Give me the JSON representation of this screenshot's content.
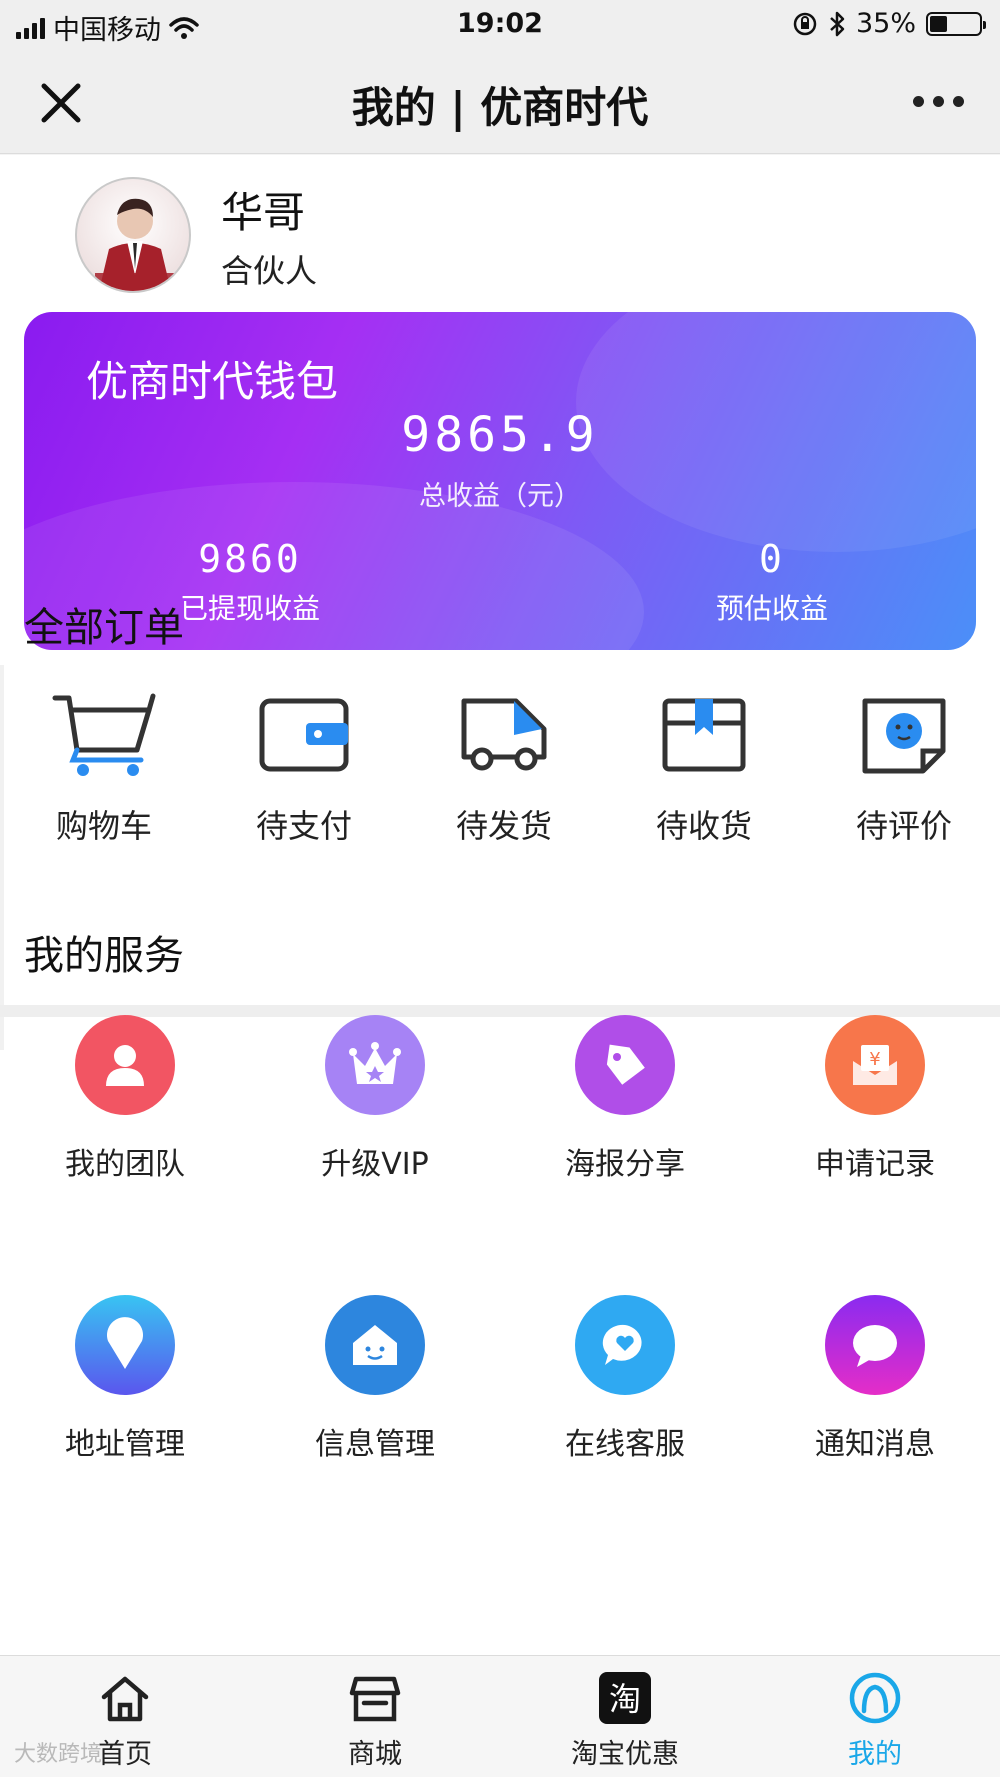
{
  "status_bar": {
    "carrier": "中国移动",
    "time": "19:02",
    "battery": "35%",
    "battery_level": 0.35
  },
  "nav": {
    "title": "我的 | 优商时代"
  },
  "profile": {
    "name": "华哥",
    "role": "合伙人"
  },
  "wallet": {
    "title": "优商时代钱包",
    "total": "9865.9",
    "total_label": "总收益（元）",
    "withdrawn": "9860",
    "withdrawn_label": "已提现收益",
    "estimated": "0",
    "estimated_label": "预估收益"
  },
  "orders": {
    "title": "全部订单",
    "items": [
      {
        "label": "购物车",
        "icon": "shopping-cart-icon"
      },
      {
        "label": "待支付",
        "icon": "wallet-icon"
      },
      {
        "label": "待发货",
        "icon": "truck-icon"
      },
      {
        "label": "待收货",
        "icon": "package-icon"
      },
      {
        "label": "待评价",
        "icon": "review-icon"
      }
    ]
  },
  "services": {
    "title": "我的服务",
    "items": [
      {
        "label": "我的团队",
        "icon": "user-icon",
        "color": "#f25563"
      },
      {
        "label": "升级VIP",
        "icon": "crown-icon",
        "color": "#a683f5"
      },
      {
        "label": "海报分享",
        "icon": "tag-icon",
        "color": "#b04ee8"
      },
      {
        "label": "申请记录",
        "icon": "envelope-yen-icon",
        "color": "#f7764b"
      },
      {
        "label": "地址管理",
        "icon": "location-pin-icon",
        "color": "#4a7cf3"
      },
      {
        "label": "信息管理",
        "icon": "home-face-icon",
        "color": "#2d86de"
      },
      {
        "label": "在线客服",
        "icon": "chat-heart-icon",
        "color": "#2fa9f2"
      },
      {
        "label": "通知消息",
        "icon": "chat-bubble-icon",
        "color": "#b232ee"
      }
    ]
  },
  "tabbar": {
    "items": [
      {
        "label": "首页",
        "icon": "home-icon"
      },
      {
        "label": "商城",
        "icon": "store-icon"
      },
      {
        "label": "淘宝优惠",
        "icon": "taobao-icon"
      },
      {
        "label": "我的",
        "icon": "profile-icon"
      }
    ],
    "active": "我的"
  },
  "watermark": "大数跨境"
}
